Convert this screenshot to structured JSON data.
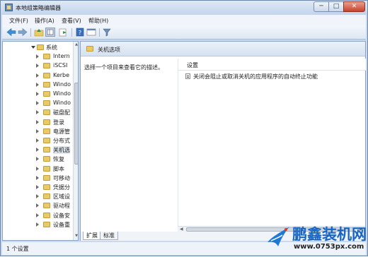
{
  "window": {
    "title": "本地组策略编辑器",
    "min": "─",
    "max": "□",
    "close": "✕"
  },
  "menu": [
    "文件(F)",
    "操作(A)",
    "查看(V)",
    "帮助(H)"
  ],
  "tree": [
    {
      "label": "系统",
      "expanded": true
    },
    {
      "label": "Intern"
    },
    {
      "label": "iSCSI"
    },
    {
      "label": "Kerbe"
    },
    {
      "label": "Windo"
    },
    {
      "label": "Windo"
    },
    {
      "label": "Windo"
    },
    {
      "label": "磁盘配"
    },
    {
      "label": "登录"
    },
    {
      "label": "电源管"
    },
    {
      "label": "分布式"
    },
    {
      "label": "关机选",
      "selected": true
    },
    {
      "label": "恢复"
    },
    {
      "label": "脚本"
    },
    {
      "label": "可移动"
    },
    {
      "label": "凭据分"
    },
    {
      "label": "区域设"
    },
    {
      "label": "驱动程"
    },
    {
      "label": "设备安"
    },
    {
      "label": "设备重"
    }
  ],
  "right": {
    "header": "关机选项",
    "description": "选择一个项目来查看它的描述。",
    "column_header": "设置",
    "settings": [
      "关闭会阻止或取消关机的应用程序的自动终止功能"
    ]
  },
  "tabs": [
    "扩展",
    "标准"
  ],
  "status": "1 个设置",
  "watermark": {
    "title": "鹏鑫装机网",
    "url": "www.0753px.com"
  },
  "colors": {
    "accent": "#1866c2",
    "folder": "#e9c968"
  }
}
